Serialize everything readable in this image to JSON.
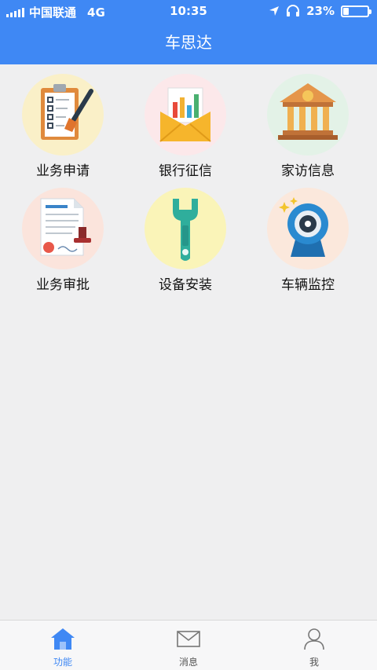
{
  "status_bar": {
    "carrier": "中国联通",
    "network": "4G",
    "time": "10:35",
    "battery": "23%",
    "battery_level": 0.23
  },
  "header": {
    "title": "车思达"
  },
  "features": [
    {
      "label": "业务申请",
      "icon": "clipboard-checklist-icon",
      "bg": "#faf0c8"
    },
    {
      "label": "银行征信",
      "icon": "envelope-report-icon",
      "bg": "#fce8ea"
    },
    {
      "label": "家访信息",
      "icon": "bank-building-icon",
      "bg": "#e3f2e7"
    },
    {
      "label": "业务审批",
      "icon": "approved-document-icon",
      "bg": "#fbe4dc"
    },
    {
      "label": "设备安装",
      "icon": "wrench-icon",
      "bg": "#faf4b8"
    },
    {
      "label": "车辆监控",
      "icon": "webcam-icon",
      "bg": "#fbe8dc"
    }
  ],
  "tabbar": {
    "tabs": [
      {
        "label": "功能",
        "icon": "home-icon",
        "active": true
      },
      {
        "label": "消息",
        "icon": "envelope-icon",
        "active": false
      },
      {
        "label": "我",
        "icon": "user-icon",
        "active": false
      }
    ],
    "active_color": "#3f88f4"
  },
  "colors": {
    "accent": "#3f88f4",
    "background": "#efeff0"
  }
}
